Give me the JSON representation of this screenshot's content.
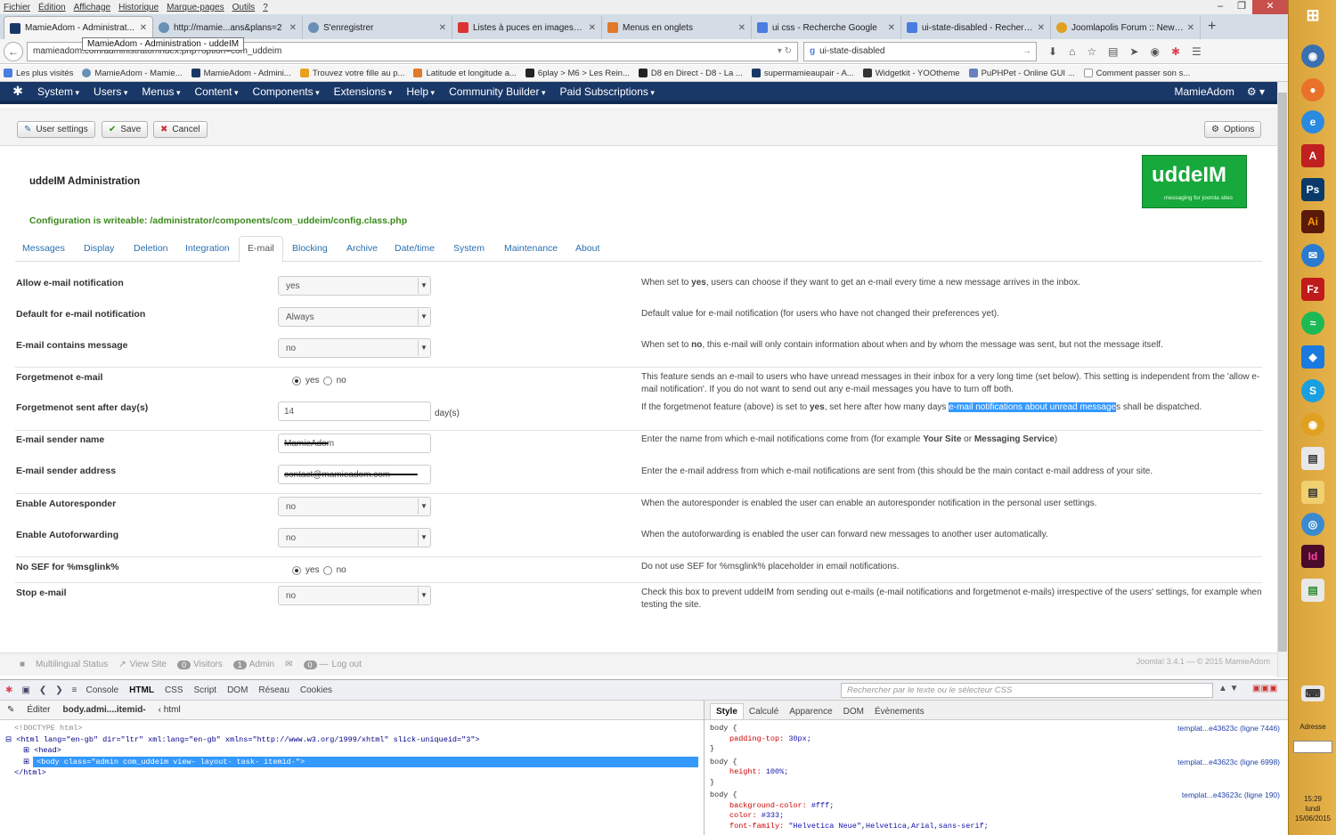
{
  "browser": {
    "menu": [
      "Fichier",
      "Édition",
      "Affichage",
      "Historique",
      "Marque-pages",
      "Outils",
      "?"
    ],
    "tabs": [
      {
        "title": "MamieAdom - Administrat...",
        "color": "#1a3867",
        "active": true
      },
      {
        "title": "http://mamie...ans&plans=2",
        "color": "#6a8fb5"
      },
      {
        "title": "S'enregistrer",
        "color": "#6a8fb5"
      },
      {
        "title": "Listes à puces en images a...",
        "color": "#d33"
      },
      {
        "title": "Menus en onglets",
        "color": "#e07a2a"
      },
      {
        "title": "ui css - Recherche Google",
        "color": "#4a7de0"
      },
      {
        "title": "ui-state-disabled - Recherc...",
        "color": "#4a7de0"
      },
      {
        "title": "Joomlapolis Forum :: New ...",
        "color": "#e0a020"
      }
    ],
    "url": "mamieadom.com/administrator/index.php?option=com_uddeim",
    "tooltip": "MamieAdom - Administration - uddeIM",
    "search": "ui-state-disabled",
    "bookmarks": [
      "Les plus visités",
      "MamieAdom - Mamie...",
      "MamieAdom - Admini...",
      "Trouvez votre fille au p...",
      "Latitude et longitude a...",
      "6play > M6 > Les Rein...",
      "D8 en Direct - D8 - La ...",
      "supermamieaupair - A...",
      "Widgetkit - YOOtheme",
      "PuPHPet - Online GUI ...",
      "Comment passer son s..."
    ]
  },
  "joomla": {
    "menu": [
      "System",
      "Users",
      "Menus",
      "Content",
      "Components",
      "Extensions",
      "Help",
      "Community Builder",
      "Paid Subscriptions"
    ],
    "site_name": "MamieAdom",
    "toolbar": {
      "user_settings": "User settings",
      "save": "Save",
      "cancel": "Cancel",
      "options": "Options"
    },
    "title": "uddeIM Administration",
    "logo_text": "uddeIM",
    "logo_sub": "messaging for joomla sites",
    "config_msg": "Configuration is writeable: /administrator/components/com_uddeim/config.class.php",
    "tabs": [
      "Messages",
      "Display",
      "Deletion",
      "Integration",
      "E-mail",
      "Blocking",
      "Archive",
      "Date/time",
      "System",
      "Maintenance",
      "About"
    ],
    "rows": {
      "allow_notif": {
        "label": "Allow e-mail notification",
        "value": "yes",
        "desc_a": "When set to ",
        "desc_b": "yes",
        "desc_c": ", users can choose if they want to get an e-mail every time a new message arrives in the inbox."
      },
      "default_notif": {
        "label": "Default for e-mail notification",
        "value": "Always",
        "desc": "Default value for e-mail notification (for users who have not changed their preferences yet)."
      },
      "contains_msg": {
        "label": "E-mail contains message",
        "value": "no",
        "desc_a": "When set to ",
        "desc_b": "no",
        "desc_c": ", this e-mail will only contain information about when and by whom the message was sent, but not the message itself."
      },
      "forgetmenot": {
        "label": "Forgetmenot e-mail",
        "yes": "yes",
        "no": "no",
        "desc": "This feature sends an e-mail to users who have unread messages in their inbox for a very long time (set below). This setting is independent from the 'allow e-mail notification'. If you do not want to send out any e-mail messages you have to turn off both."
      },
      "forgetmenot_days": {
        "label": "Forgetmenot sent after day(s)",
        "value": "14",
        "unit": "day(s)",
        "desc_a": "If the forgetmenot feature (above) is set to ",
        "desc_b": "yes",
        "desc_c": ", set here after how many days ",
        "desc_hl": "e-mail notifications about unread message",
        "desc_d": "s shall be dispatched."
      },
      "sender_name": {
        "label": "E-mail sender name",
        "value": "MamieAdom",
        "desc_a": "Enter the name from which e-mail notifications come from (for example ",
        "desc_b": "Your Site",
        "desc_c": " or ",
        "desc_d": "Messaging Service",
        "desc_e": ")"
      },
      "sender_addr": {
        "label": "E-mail sender address",
        "value": "contact@mamieadom.com",
        "desc": "Enter the e-mail address from which e-mail notifications are sent from (this should be the main contact e-mail address of your site."
      },
      "autoresponder": {
        "label": "Enable Autoresponder",
        "value": "no",
        "desc": "When the autoresponder is enabled the user can enable an autoresponder notification in the personal user settings."
      },
      "autoforward": {
        "label": "Enable Autoforwarding",
        "value": "no",
        "desc": "When the autoforwarding is enabled the user can forward new messages to another user automatically."
      },
      "nosef": {
        "label": "No SEF for %msglink%",
        "yes": "yes",
        "no": "no",
        "desc": "Do not use SEF for %msglink% placeholder in email notifications."
      },
      "stop": {
        "label": "Stop e-mail",
        "value": "no",
        "desc": "Check this box to prevent uddeIM from sending out e-mails (e-mail notifications and forgetmenot e-mails) irrespective of the users' settings, for example when testing the site."
      }
    },
    "status": {
      "multilingual": "Multilingual Status",
      "view_site": "View Site",
      "visitors_count": "0",
      "visitors": "Visitors",
      "admin_count": "1",
      "admin": "Admin",
      "msg_count": "0",
      "logout": "Log out",
      "version": "Joomla! 3.4.1 — © 2015 MamieAdom"
    }
  },
  "firebug": {
    "tabs": [
      "Console",
      "HTML",
      "CSS",
      "Script",
      "DOM",
      "Réseau",
      "Cookies"
    ],
    "search_placeholder": "Rechercher par le texte ou le sélecteur CSS",
    "edit": "Éditer",
    "path1": "body.admi....itemid-",
    "path2": "html",
    "html_lines": [
      "<!DOCTYPE html>",
      "<html lang=\"en-gb\" dir=\"ltr\" xml:lang=\"en-gb\" xmlns=\"http://www.w3.org/1999/xhtml\" slick-uniqueid=\"3\">",
      "<head>",
      "<body class=\"admin com_uddeim view- layout- task- itemid-\">",
      "</html>"
    ],
    "side_tabs": [
      "Style",
      "Calculé",
      "Apparence",
      "DOM",
      "Évènements"
    ],
    "css_rules": [
      {
        "sel": "body {",
        "props": [
          [
            "padding-top:",
            "30px;"
          ]
        ],
        "src": "templat...e43623c (ligne 7446)"
      },
      {
        "sel": "body {",
        "props": [
          [
            "height:",
            "100%;"
          ]
        ],
        "src": "templat...e43623c (ligne 6998)"
      },
      {
        "sel": "body {",
        "props": [
          [
            "background-color:",
            "#fff;"
          ],
          [
            "color:",
            "#333;"
          ],
          [
            "font-family:",
            "\"Helvetica Neue\",Helvetica,Arial,sans-serif;"
          ]
        ],
        "src": "templat...e43623c (ligne 190)"
      }
    ]
  },
  "taskbar": {
    "address": "Adresse",
    "time": "15:29",
    "day": "lundi",
    "date": "15/06/2015"
  },
  "colors": {
    "joomla_nav": "#1a3867",
    "link": "#2a6fb0",
    "success": "#3a8a1a",
    "logo": "#17a93b",
    "highlight": "#3399ff"
  }
}
